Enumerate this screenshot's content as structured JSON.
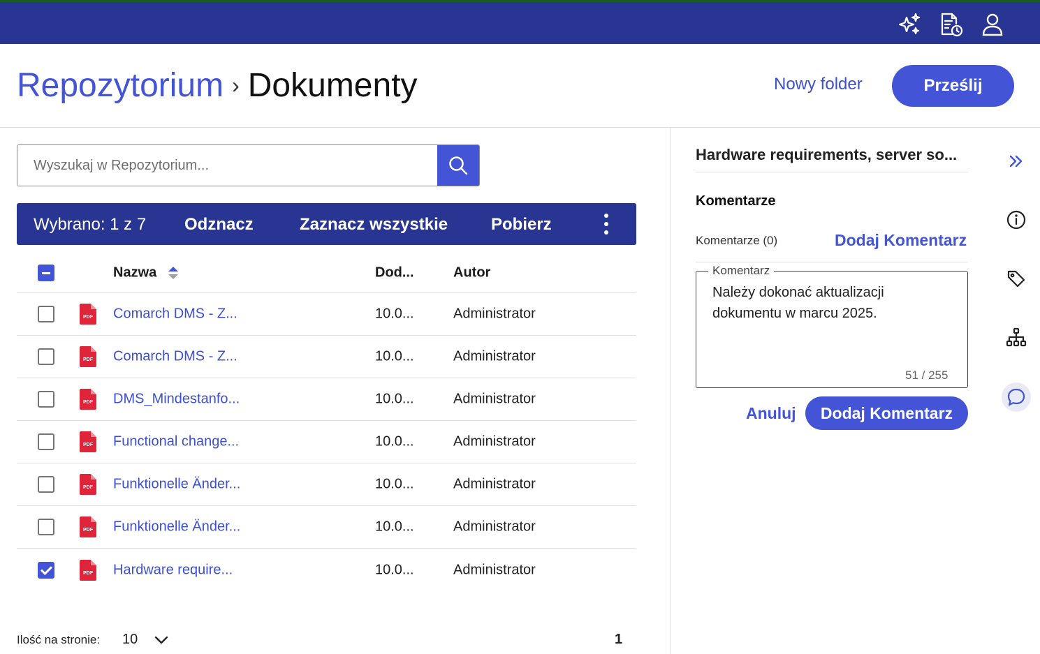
{
  "colors": {
    "topbar": "#283593",
    "accent": "#4355d6",
    "pdf": "#e0253b"
  },
  "topbar": {
    "icons": [
      "sparkles-icon",
      "document-clock-icon",
      "user-icon"
    ]
  },
  "header": {
    "breadcrumb_root": "Repozytorium",
    "breadcrumb_separator": "›",
    "breadcrumb_current": "Dokumenty",
    "new_folder_label": "Nowy folder",
    "upload_label": "Prześlij"
  },
  "search": {
    "placeholder": "Wyszukaj w Repozytorium..."
  },
  "selection_bar": {
    "selected_text": "Wybrano: 1 z 7",
    "deselect_label": "Odznacz",
    "select_all_label": "Zaznacz wszystkie",
    "download_label": "Pobierz"
  },
  "table": {
    "columns": {
      "name": "Nazwa",
      "date": "Dod...",
      "author": "Autor"
    },
    "rows": [
      {
        "name": "Comarch DMS - Z...",
        "date": "10.0...",
        "author": "Administrator",
        "checked": false
      },
      {
        "name": "Comarch DMS - Z...",
        "date": "10.0...",
        "author": "Administrator",
        "checked": false
      },
      {
        "name": "DMS_Mindestanfo...",
        "date": "10.0...",
        "author": "Administrator",
        "checked": false
      },
      {
        "name": "Functional change...",
        "date": "10.0...",
        "author": "Administrator",
        "checked": false
      },
      {
        "name": "Funktionelle Änder...",
        "date": "10.0...",
        "author": "Administrator",
        "checked": false
      },
      {
        "name": "Funktionelle Änder...",
        "date": "10.0...",
        "author": "Administrator",
        "checked": false
      },
      {
        "name": "Hardware require...",
        "date": "10.0...",
        "author": "Administrator",
        "checked": true
      }
    ]
  },
  "pagination": {
    "per_page_label": "Ilość na stronie:",
    "per_page_value": "10",
    "page": "1"
  },
  "panel": {
    "title": "Hardware requirements, server so...",
    "section_title": "Komentarze",
    "count_label": "Komentarze (0)",
    "add_link_label": "Dodaj Komentarz",
    "comment_legend": "Komentarz",
    "comment_text": "Należy dokonać aktualizacji\ndokumentu w marcu 2025.",
    "counter": "51 / 255",
    "cancel_label": "Anuluj",
    "add_button_label": "Dodaj Komentarz"
  }
}
